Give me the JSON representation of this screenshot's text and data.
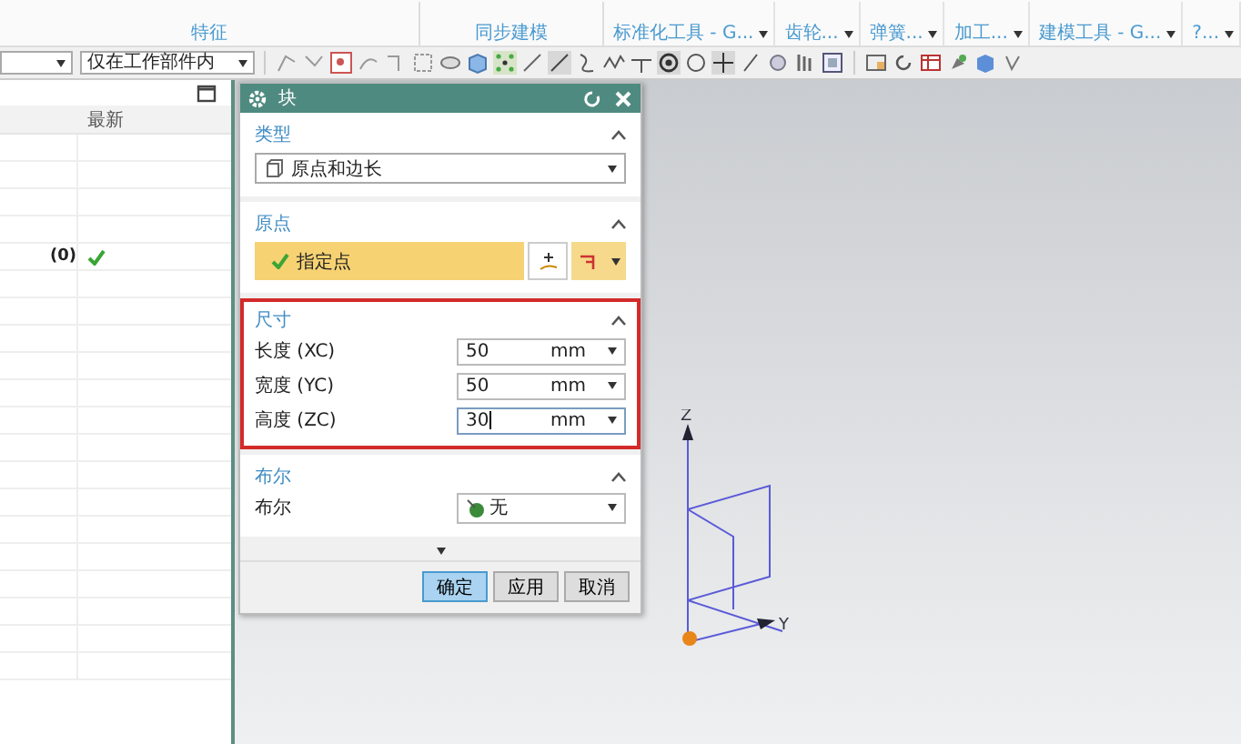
{
  "ribbon": {
    "groups": [
      {
        "label": "特征"
      },
      {
        "label": "同步建模"
      }
    ],
    "tabs": [
      {
        "label": "标准化工具 - G..."
      },
      {
        "label": "齿轮..."
      },
      {
        "label": "弹簧..."
      },
      {
        "label": "加工..."
      },
      {
        "label": "建模工具 - G..."
      },
      {
        "label": "?..."
      }
    ]
  },
  "toolbar": {
    "scope": {
      "value": "仅在工作部件内"
    }
  },
  "navigator": {
    "columns": [
      "最新"
    ],
    "rows": [
      {
        "label": "(0)",
        "latest": true
      }
    ]
  },
  "dialog": {
    "title": "块",
    "sections": [
      {
        "kind": "type",
        "title": "类型",
        "expanded": true,
        "value": "原点和边长"
      },
      {
        "kind": "point",
        "title": "原点",
        "expanded": true,
        "label": "指定点",
        "specified": true
      },
      {
        "kind": "fields",
        "title": "尺寸",
        "expanded": true,
        "highlighted": true,
        "fields": [
          {
            "label": "长度 (XC)",
            "value": "50",
            "unit": "mm",
            "focused": false
          },
          {
            "label": "宽度 (YC)",
            "value": "50",
            "unit": "mm",
            "focused": false
          },
          {
            "label": "高度 (ZC)",
            "value": "30",
            "unit": "mm",
            "focused": true
          }
        ]
      },
      {
        "kind": "boolean",
        "title": "布尔",
        "expanded": true,
        "label": "布尔",
        "value": "无"
      }
    ],
    "buttons": [
      {
        "label": "确定",
        "default": true
      },
      {
        "label": "应用",
        "default": false
      },
      {
        "label": "取消",
        "default": false
      }
    ]
  },
  "viewport": {
    "axes": [
      {
        "label": "Z"
      },
      {
        "label": "Y"
      }
    ]
  }
}
